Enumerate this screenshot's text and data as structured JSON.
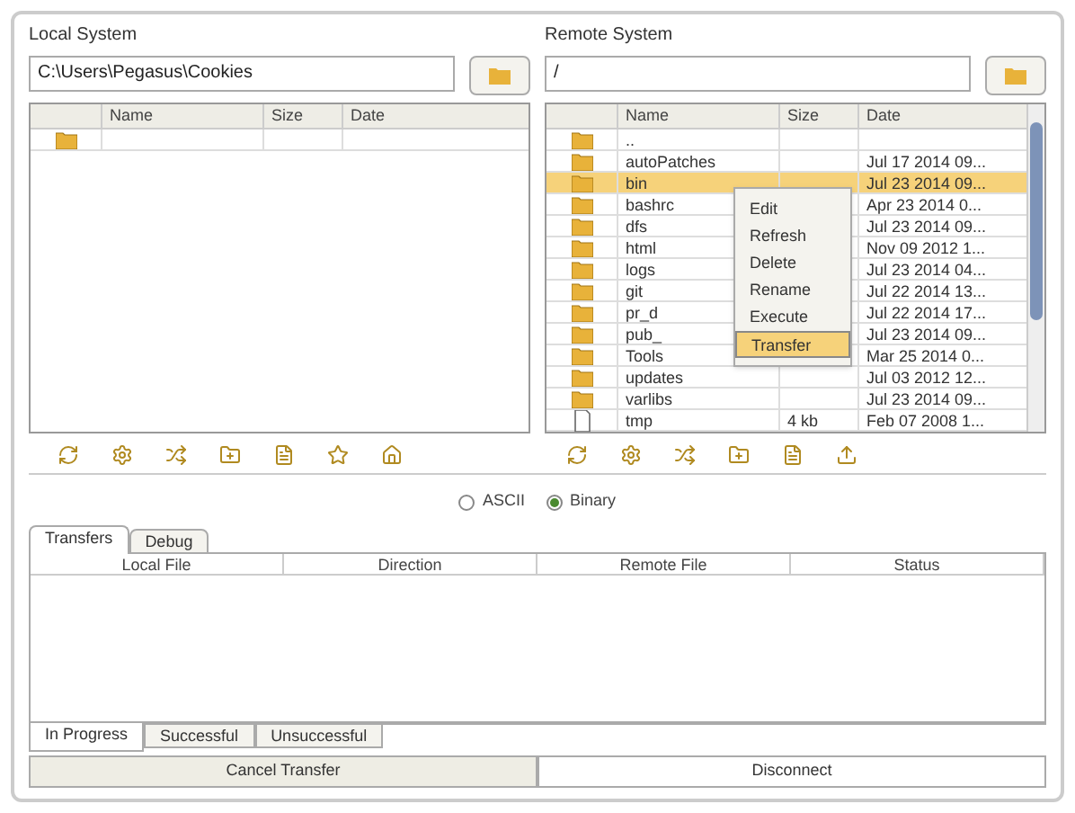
{
  "local": {
    "title": "Local System",
    "path": "C:\\Users\\Pegasus\\Cookies",
    "columns": [
      "Name",
      "Size",
      "Date"
    ],
    "rows": [
      {
        "kind": "folder",
        "name": "",
        "size": "",
        "date": "",
        "selected": false
      }
    ]
  },
  "remote": {
    "title": "Remote System",
    "path": "/",
    "columns": [
      "Name",
      "Size",
      "Date"
    ],
    "rows": [
      {
        "kind": "folder",
        "name": "..",
        "size": "",
        "date": "",
        "selected": false
      },
      {
        "kind": "folder",
        "name": "autoPatches",
        "size": "",
        "date": "Jul 17 2014 09...",
        "selected": false
      },
      {
        "kind": "folder",
        "name": "bin",
        "size": "",
        "date": "Jul 23 2014 09...",
        "selected": true
      },
      {
        "kind": "folder",
        "name": "bashrc",
        "size": "",
        "date": "Apr 23 2014 0...",
        "selected": false
      },
      {
        "kind": "folder",
        "name": "dfs",
        "size": "",
        "date": "Jul 23 2014 09...",
        "selected": false
      },
      {
        "kind": "folder",
        "name": "html",
        "size": "",
        "date": "Nov 09 2012 1...",
        "selected": false
      },
      {
        "kind": "folder",
        "name": "logs",
        "size": "",
        "date": "Jul 23 2014 04...",
        "selected": false
      },
      {
        "kind": "folder",
        "name": "git",
        "size": "",
        "date": "Jul 22 2014 13...",
        "selected": false
      },
      {
        "kind": "folder",
        "name": "pr_d",
        "size": "",
        "date": "Jul 22 2014 17...",
        "selected": false
      },
      {
        "kind": "folder",
        "name": "pub_",
        "size": "",
        "date": "Jul 23 2014 09...",
        "selected": false
      },
      {
        "kind": "folder",
        "name": "Tools",
        "size": "",
        "date": "Mar 25 2014 0...",
        "selected": false
      },
      {
        "kind": "folder",
        "name": "updates",
        "size": "",
        "date": "Jul 03 2012 12...",
        "selected": false
      },
      {
        "kind": "folder",
        "name": "varlibs",
        "size": "",
        "date": "Jul 23 2014 09...",
        "selected": false
      },
      {
        "kind": "file",
        "name": "tmp",
        "size": "4 kb",
        "date": "Feb 07 2008 1...",
        "selected": false
      }
    ]
  },
  "context_menu": [
    {
      "label": "Edit",
      "selected": false
    },
    {
      "label": "Refresh",
      "selected": false
    },
    {
      "label": "Delete",
      "selected": false
    },
    {
      "label": "Rename",
      "selected": false
    },
    {
      "label": "Execute",
      "selected": false
    },
    {
      "label": "Transfer",
      "selected": true
    }
  ],
  "modes": [
    {
      "label": "ASCII",
      "selected": false
    },
    {
      "label": "Binary",
      "selected": true
    }
  ],
  "tabs": [
    {
      "label": "Transfers",
      "selected": true
    },
    {
      "label": "Debug",
      "selected": false
    }
  ],
  "transfer_columns": [
    "Local File",
    "Direction",
    "Remote File",
    "Status"
  ],
  "transfer_tabs": [
    {
      "label": "In Progress",
      "selected": true
    },
    {
      "label": "Successful",
      "selected": false
    },
    {
      "label": "Unsuccessful",
      "selected": false
    }
  ],
  "buttons": [
    {
      "label": "Cancel Transfer",
      "selected": true
    },
    {
      "label": "Disconnect",
      "selected": false
    }
  ]
}
